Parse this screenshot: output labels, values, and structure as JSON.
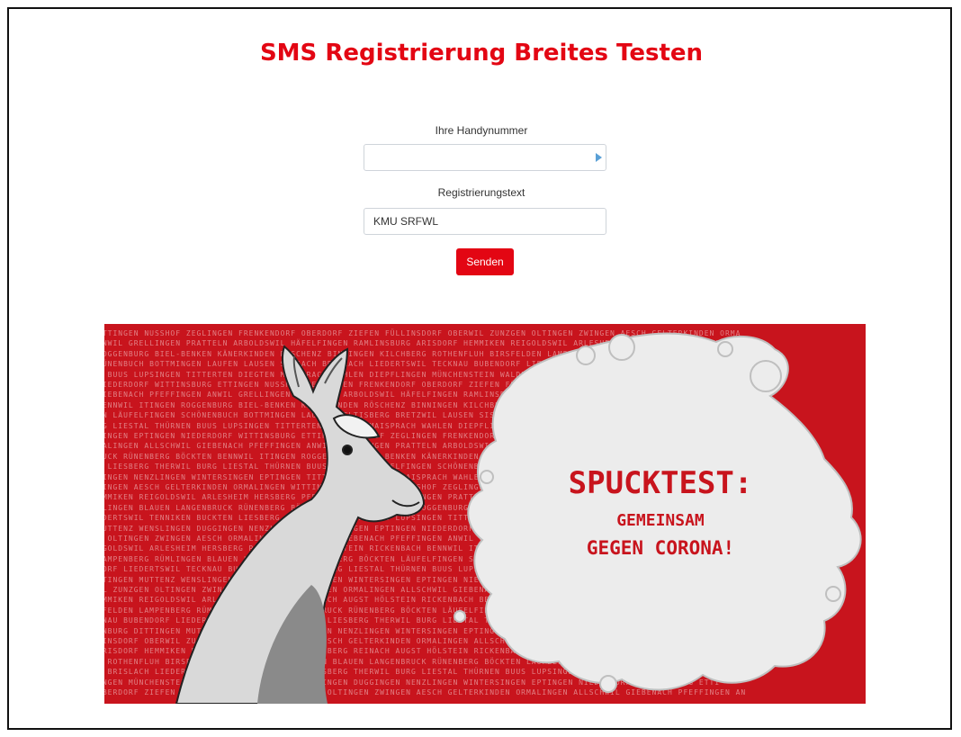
{
  "page": {
    "title": "SMS Registrierung Breites Testen"
  },
  "form": {
    "phone_label": "Ihre Handynummer",
    "phone_value": "",
    "text_label": "Registrierungstext",
    "text_value": "KMU SRFWL",
    "submit_label": "Senden"
  },
  "banner": {
    "headline": "SPUCKTEST:",
    "line2": "GEMEINSAM",
    "line3": "GEGEN CORONA!",
    "background_color": "#c8141d",
    "background_rows": [
      "ETTINGEN NUSSHOF ZEGLINGEN FRENKENDORF OBERDORF ZIEFEN FÜLLINSDORF OBERWIL ZUNZGEN OLTINGEN ZWINGEN AESCH GELTERKINDEN ORMA",
      "ANWIL GRELLINGEN PRATTELN ARBOLDSWIL HÄFELFINGEN RAMLINSBURG ARISDORF HEMMIKEN REIGOLDSWIL ARLESHEIM HERSBERG REINACH AUGST",
      "ROGGENBURG BIEL-BENKEN KÄNERKINDEN RÖSCHENZ BINNINGEN KILCHBERG ROTHENFLUH BIRSFELDEN LAMPENBERG RÜMLINGEN LAUWIL LANGENBRUC",
      "RÜNENBUCH BOTTMINGEN LAUFEN LAUSEN SISSACH BRISLACH LIEDERTSWIL TECKNAU BUBENDORF LIESBERG TENNIKEN BUCKTEN",
      "N BUUS LUPSINGEN TITTERTEN DIEGTEN MAISPRACH WAHLEN DIEPFLINGEN MÜNCHENSTEIN WALDENBURG DITTINGEN MUTTENZ WENSLINGEN DUGGINGE",
      "NIEDERDORF WITTINSBURG ETTINGEN NUSSHOF ZEGLINGEN FRENKENDORF OBERDORF ZIEFEN FÜLLINSDORF OBERWIL ZUNZGEN ZWINGEN AESC",
      "GIEBENACH PFEFFINGEN ANWIL GRELLINGEN PRATTELN ARBOLDSWIL HÄFELFINGEN RAMLINSBURG ARISDORF HEMMIKEN REIGOLDSWIL ARLESHEIM HERS",
      "BENNWIL ITINGEN ROGGENBURG BIEL-BENKEN KÄNERKINDEN RÖSCHENZ BINNINGEN KILCHBERG ROTHENFLUH BIRSFELDEN LAMPENBERG RÜMLINGEN B",
      "EN LÄUFELFINGEN SCHÖNENBUCH BOTTMINGEN LAUFEN SELTISBERG BRETZWIL LAUSEN SISSACH BRISLACH LIEDERTSWIL TECKNAU BUBENDORF LIEDERTSW",
      "RG LIESTAL THÜRNEN BUUS LUPSINGEN TITTERTEN DIEGTEN MAISPRACH WAHLEN DIEPFLINGEN MÜNCHENSTEIN WALDENBURG DITTINGEN MUTTENZ W",
      "SINGEN EPTINGEN NIEDERDORF WITTINSBURG ETTINGEN NUSSHOF ZEGLINGEN FRENKENDORF OBERDORF ZIEFEN FÜLLINSDORF OBERWIL ZUNZGEN OLTI",
      "MALINGEN ALLSCHWIL GIEBENACH PFEFFINGEN ANWIL GRELLINGEN PRATTELN ARBOLDSWIL HÄFELFINGEN RAMLINSBURG ARISDORF HEMMIKEN REIGOLD",
      "RUCK RÜNENBERG BÖCKTEN BENNWIL ITINGEN ROGGENBURG BIEL-BENKEN KÄNERKINDEN RÖSCHENZ BINNINGEN KILCHBERG ROTHENFLUH BIRSFELDEN",
      "K LIESBERG THERWIL BURG LIESTAL THÜRNEN BUUS LAUWIL LÄUFELFINGEN SCHÖNENBUCH BOTTMINGEN LAUFEN SELTISBERG BRETZWIL LAUSEN TECKNAU",
      "GINGEN NENZLINGEN WINTERSINGEN EPTINGEN TITTERTEN DIEGTEN MAISPRACH WAHLEN DIEPFLINGEN MÜNCHENSTEIN WALDENBURG DITTINGEN WALDENB",
      "WINGEN AESCH GELTERKINDEN ORMALINGEN WITTINSBURG ETTINGEN NUSSHOF ZEGLINGEN FRENKENDORF OBERDORF ZIEFEN FÜLLINSDORF OBERWIL FÜLLINSDO",
      "EMMIKEN REIGOLDSWIL ARLESHEIM HERSBERG PFEFFINGEN ANWIL GRELLINGEN PRATTELN ARBOLDSWIL HÄFELFINGEN RAMLINSBURG ARISDORF RAMLINSDU",
      "RLINGEN BLAUEN LANGENBRUCK RÜNENBERG BÖCKTEN BENNWIL ITINGEN ROGGENBURG BIEL-BENKEN KÄNERKINDEN RÖSCHENZ BINNINGEN SISSACH B",
      "EDERTSWIL TENNIKEN BUCKTEN LIESBERG LIESTAL THÜRNEN BUUS LUPSINGEN TITTERTEN DIEGTEN MAISPRACH WAHLEN DIEPFLINGEN MÜNCHENSTEIN D",
      "MUTTENZ WENSLINGEN DUGGINGEN NENZLINGEN WINTERSINGEN EPTINGEN NIEDERDORF WITTINSBURG ETTINGEN NUSSHOF ZEGLINGEN FRENKENDORF OI",
      "N OLTINGEN ZWINGEN AESCH ORMALINGEN ALLSCHWIL GIEBENACH PFEFFINGEN ANWIL GRELLINGEN PRATTELN ARBOLDSWIL HÄFELFINGEN HÄFELFIN",
      "IGOLDSWIL ARLESHEIM HERSBERG REINACH AUGST HÖLSTEIN RICKENBACH BENNWIL ITINGEN ROGGENBURG BIEL-BENKEN KÄNERKINDEN RÖSCHENZ BI",
      "LAMPENBERG RÜMLINGEN BLAUEN LANGENBRUCK RÜNENBERG BÖCKTEN LÄUFELFINGEN SCHÖNENBUCH BOTTMINGEN LAUFEN SELTISBERG BRETZWIL LA",
      "DORF LIEDERTSWIL TECKNAU BUBENDORF THERWIL BURG LIESTAL THÜRNEN BUUS LUPSINGEN TITTERTEN DIEGTEN MAISPRACH WAHLEN DI",
      "TTINGEN MUTTENZ WENSLINGEN DUGGINGEN NENZLINGEN WINTERSINGEN EPTINGEN NIEDERDORF WITTINSBURG ETTINGEN NUSSHOF FRENKE",
      "IL ZUNZGEN OLTINGEN ZWINGEN AESCH GELTERKINDEN ORMALINGEN ALLSCHWIL GIEBENACH PFEFFINGEN ANWIL GRELLINGEN ARBOLDSWIL",
      "EMMIKEN REIGOLDSWIL ARLESHEIM HERSBERG REINACH AUGST HÖLSTEIN RICKENBACH BENNWIL ITINGEN ROGGENBURG BIEL-BENKEN KÄNERKINDEN R",
      "SFELDEN LAMPENBERG RÜMLINGEN BLAUEN LANGENBRUCK RÜNENBERG BÖCKTEN LÄUFELFINGEN SCHÖNENBUCH BOTTMINGEN LAUFEN SELTISBERG BRETZ",
      "KNAU BUBENDORF LIEDERTSWIL TENNIKEN BUCKTEN LIESBERG THERWIL BURG LIESTAL THÜRNEN BUUS LUPSINGEN TITTERTEN DIEGTEN MAISPRACH",
      "ENBURG DITTINGEN MUTTENZ WENSLINGEN DUGGINGEN NENZLINGEN WINTERSINGEN EPTINGEN NIEDERDORF WITTINSBURG ETTINGEN NUSSHOF ZEGLING",
      "LINSDORF OBERWIL ZUNZGEN OLTINGEN ZWINGEN AESCH GELTERKINDEN ORMALINGEN ALLSCHWIL GIEBENACH PFEFFINGEN ANWIL GRELLINGEN PRATT",
      "ARISDORF HEMMIKEN REIGOLDSWIL ARLESHEIM HERSBERG REINACH AUGST HÖLSTEIN RICKENBACH BENNWIL ITINGEN ROGGENBURG BIEL-BENKEN K",
      "N ROTHENFLUH BIRSFELDEN LAMPENBERG RÜMLINGEN BLAUEN LANGENBRUCK RÜNENBERG BÖCKTEN LÄUFELFINGEN SCHÖNENBUCH BOTTMINGEN LAUF",
      "N BRISLACH LIEDERTSWIL TENNIKEN BUCKTEN LIESBERG THERWIL BURG LIESTAL THÜRNEN BUUS LUPSINGEN TITTE",
      "INGEN MÜNCHENSTEIN WALDENBURG MUTTENZ WENSLINGEN DUGGINGEN NENZLINGEN WINTERSINGEN EPTINGEN NIEDERDORF WITTINSBURG ETTI",
      "OBERDORF ZIEFEN FÜLLINSDORF OBERWIL ZUNZGEN OLTINGEN ZWINGEN AESCH GELTERKINDEN ORMALINGEN ALLSCHWIL GIEBENACH PFEFFINGEN AN"
    ]
  }
}
